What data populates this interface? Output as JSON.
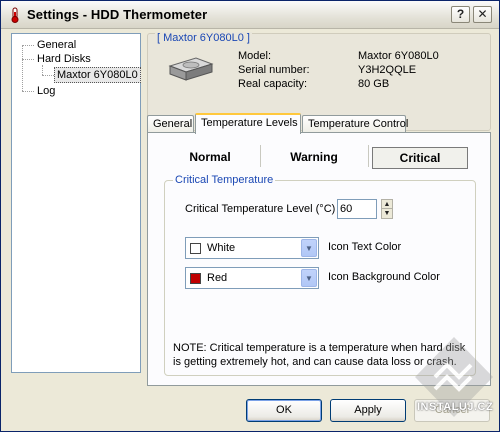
{
  "window": {
    "title": "Settings - HDD Thermometer",
    "help_label": "?",
    "close_label": "✕"
  },
  "tree": {
    "items": [
      {
        "label": "General"
      },
      {
        "label": "Hard Disks"
      },
      {
        "label": "Maxtor 6Y080L0"
      },
      {
        "label": "Log"
      }
    ]
  },
  "drive": {
    "title": "[ Maxtor 6Y080L0 ]",
    "rows": [
      {
        "label": "Model:",
        "value": "Maxtor 6Y080L0"
      },
      {
        "label": "Serial number:",
        "value": "Y3H2QQLE"
      },
      {
        "label": "Real capacity:",
        "value": "80 GB"
      }
    ]
  },
  "tabs": [
    {
      "label": "General"
    },
    {
      "label": "Temperature Levels"
    },
    {
      "label": "Temperature Control"
    }
  ],
  "levels": [
    {
      "label": "Normal"
    },
    {
      "label": "Warning"
    },
    {
      "label": "Critical"
    }
  ],
  "critical": {
    "group_title": "Critical Temperature",
    "level_label": "Critical Temperature Level (°C)",
    "level_value": "60",
    "text_color": {
      "value": "White",
      "swatch": "#ffffff",
      "label": "Icon Text Color"
    },
    "bg_color": {
      "value": "Red",
      "swatch": "#c00000",
      "label": "Icon Background Color"
    },
    "note": "NOTE: Critical temperature is a temperature when hard disk is getting extremely hot, and can cause data loss or crash."
  },
  "buttons": {
    "ok": "OK",
    "apply": "Apply",
    "cancel": "Cancel"
  },
  "watermark": {
    "text": "INSTALUJ.CZ"
  }
}
